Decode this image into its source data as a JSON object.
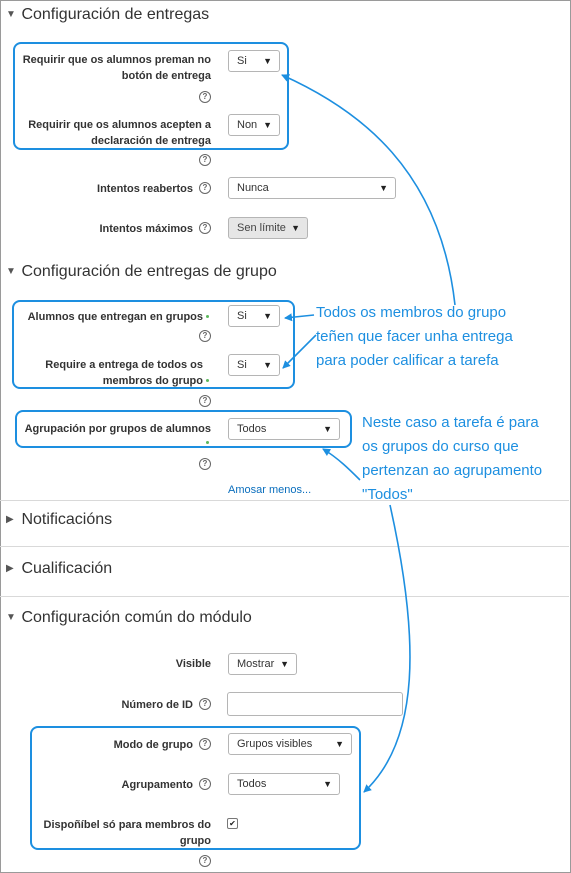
{
  "sections": {
    "entregas": "Configuración de entregas",
    "grupo": "Configuración de entregas de grupo",
    "notificacions": "Notificacións",
    "cualificacion": "Cualificación",
    "comun": "Configuración común do módulo"
  },
  "fields": {
    "premer_boton": {
      "label": "Requirir que os alumnos preman no botón de entrega",
      "value": "Si"
    },
    "aceptar_declaracion": {
      "label": "Requirir que os alumnos acepten a declaración de entrega",
      "value": "Non"
    },
    "intentos_reabertos": {
      "label": "Intentos reabertos",
      "value": "Nunca"
    },
    "intentos_maximos": {
      "label": "Intentos máximos",
      "value": "Sen límite"
    },
    "alumnos_grupos": {
      "label": "Alumnos que entregan en grupos",
      "value": "Si"
    },
    "todos_membros": {
      "label": "Require a entrega de todos os membros do grupo",
      "value": "Si"
    },
    "agrupacion": {
      "label": "Agrupación por grupos de alumnos",
      "value": "Todos"
    },
    "visible": {
      "label": "Visible",
      "value": "Mostrar"
    },
    "numero_id": {
      "label": "Número de ID",
      "value": ""
    },
    "modo_grupo": {
      "label": "Modo de grupo",
      "value": "Grupos visibles"
    },
    "agrupamento": {
      "label": "Agrupamento",
      "value": "Todos"
    },
    "disponible_membros": {
      "label": "Dispoñíbel só para membros do grupo",
      "checked": true
    }
  },
  "show_less_link": "Amosar menos...",
  "notes": {
    "group_note": [
      "Todos os membros do grupo",
      "teñen que facer unha entrega",
      "para poder calificar a tarefa"
    ],
    "grouping_note": [
      "Neste caso a tarefa é para",
      "os grupos do curso que",
      "pertenzan ao agrupamento",
      "\"Todos\""
    ]
  },
  "colors": {
    "annotation": "#1d8fe0",
    "required_dot": "#5cb85c"
  },
  "icons": {
    "help": "help-icon",
    "expanded": "triangle-down-icon",
    "collapsed": "triangle-right-icon"
  }
}
